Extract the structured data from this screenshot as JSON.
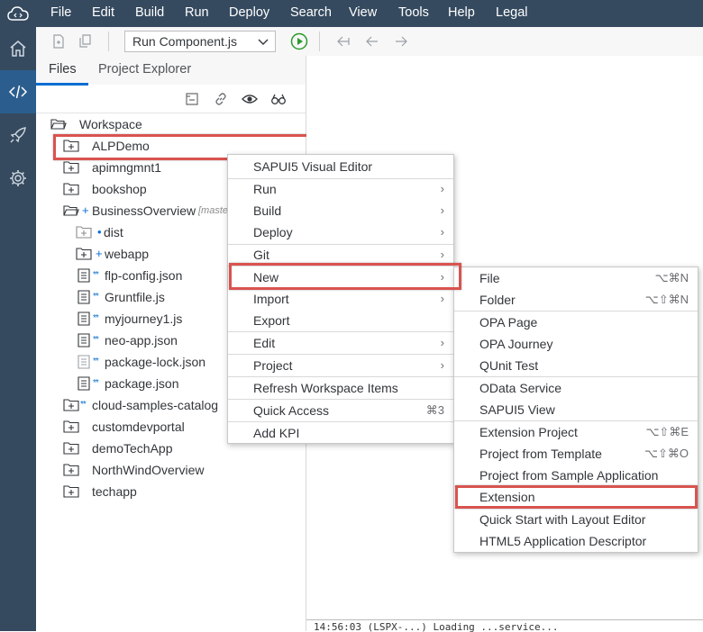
{
  "menubar": {
    "items": [
      "File",
      "Edit",
      "Build",
      "Run",
      "Deploy",
      "Search",
      "View",
      "Tools",
      "Help",
      "Legal"
    ]
  },
  "toolbar": {
    "run_select": "Run Component.js"
  },
  "files_panel": {
    "tabs": [
      "Files",
      "Project Explorer"
    ],
    "tree": [
      {
        "label": "Workspace",
        "git": ""
      },
      {
        "label": "ALPDemo",
        "git": ""
      },
      {
        "label": "apimngmnt1",
        "git": ""
      },
      {
        "label": "bookshop",
        "git": ""
      },
      {
        "label": "BusinessOverview",
        "git": "+",
        "branch": "[maste"
      },
      {
        "label": "dist",
        "git": "•"
      },
      {
        "label": "webapp",
        "git": "+"
      },
      {
        "label": "flp-config.json",
        "git": "**"
      },
      {
        "label": "Gruntfile.js",
        "git": "**"
      },
      {
        "label": "myjourney1.js",
        "git": "**"
      },
      {
        "label": "neo-app.json",
        "git": "**"
      },
      {
        "label": "package-lock.json",
        "git": "**"
      },
      {
        "label": "package.json",
        "git": "**"
      },
      {
        "label": "cloud-samples-catalog",
        "git": "**"
      },
      {
        "label": "customdevportal",
        "git": ""
      },
      {
        "label": "demoTechApp",
        "git": ""
      },
      {
        "label": "NorthWindOverview",
        "git": ""
      },
      {
        "label": "techapp",
        "git": ""
      }
    ]
  },
  "context_menu": {
    "items": [
      {
        "label": "SAPUI5 Visual Editor",
        "arrow": "",
        "shortcut": ""
      },
      {
        "label": "Run",
        "arrow": "›",
        "shortcut": ""
      },
      {
        "label": "Build",
        "arrow": "›",
        "shortcut": ""
      },
      {
        "label": "Deploy",
        "arrow": "›",
        "shortcut": ""
      },
      {
        "label": "Git",
        "arrow": "›",
        "shortcut": ""
      },
      {
        "label": "New",
        "arrow": "›",
        "shortcut": ""
      },
      {
        "label": "Import",
        "arrow": "›",
        "shortcut": ""
      },
      {
        "label": "Export",
        "arrow": "",
        "shortcut": ""
      },
      {
        "label": "Edit",
        "arrow": "›",
        "shortcut": ""
      },
      {
        "label": "Project",
        "arrow": "›",
        "shortcut": ""
      },
      {
        "label": "Refresh Workspace Items",
        "arrow": "",
        "shortcut": ""
      },
      {
        "label": "Quick Access",
        "arrow": "",
        "shortcut": "⌘3"
      },
      {
        "label": "Add KPI",
        "arrow": "",
        "shortcut": ""
      }
    ]
  },
  "new_submenu": {
    "items": [
      {
        "label": "File",
        "shortcut": "⌥⌘N"
      },
      {
        "label": "Folder",
        "shortcut": "⌥⇧⌘N"
      },
      {
        "label": "OPA Page",
        "shortcut": ""
      },
      {
        "label": "OPA Journey",
        "shortcut": ""
      },
      {
        "label": "QUnit Test",
        "shortcut": ""
      },
      {
        "label": "OData Service",
        "shortcut": ""
      },
      {
        "label": "SAPUI5 View",
        "shortcut": ""
      },
      {
        "label": "Extension Project",
        "shortcut": "⌥⇧⌘E"
      },
      {
        "label": "Project from Template",
        "shortcut": "⌥⇧⌘O"
      },
      {
        "label": "Project from Sample Application",
        "shortcut": ""
      },
      {
        "label": "Extension",
        "shortcut": ""
      },
      {
        "label": "Quick Start with Layout Editor",
        "shortcut": ""
      },
      {
        "label": "HTML5 Application Descriptor",
        "shortcut": ""
      }
    ]
  },
  "console": {
    "text": "14:56:03 (LSPX-...) Loading ...service..."
  },
  "colors": {
    "shell": "#354a5f",
    "accent": "#0a6ed1",
    "highlight": "#d9534f"
  }
}
